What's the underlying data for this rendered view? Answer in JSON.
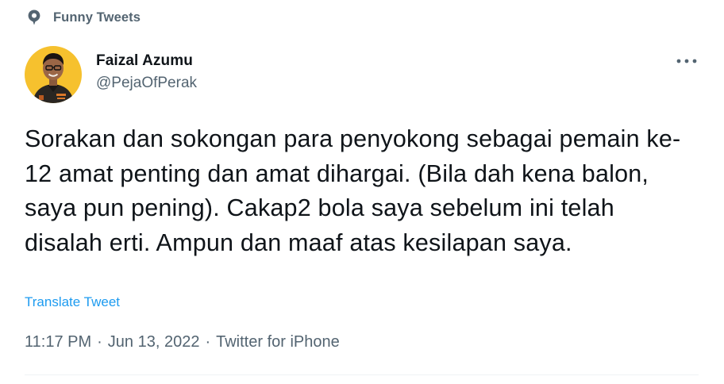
{
  "context": {
    "icon": "pin-icon",
    "label": "Funny Tweets"
  },
  "author": {
    "display_name": "Faizal Azumu",
    "handle": "@PejaOfPerak",
    "avatar_icon": "avatar"
  },
  "menu": {
    "icon": "more-icon"
  },
  "tweet": {
    "text": "Sorakan dan sokongan para penyokong sebagai pemain ke-12 amat penting dan amat dihargai. (Bila dah kena balon, saya pun pening). Cakap2 bola saya sebelum ini telah disalah erti. Ampun dan maaf atas kesilapan saya.",
    "translate_label": "Translate Tweet"
  },
  "meta": {
    "time": "11:17 PM",
    "separator": "·",
    "date": "Jun 13, 2022",
    "source": "Twitter for iPhone"
  },
  "colors": {
    "text_primary": "#0f1419",
    "text_secondary": "#536471",
    "link": "#1d9bf0",
    "avatar_bg": "#f6c12e",
    "divider": "#eff3f4"
  }
}
